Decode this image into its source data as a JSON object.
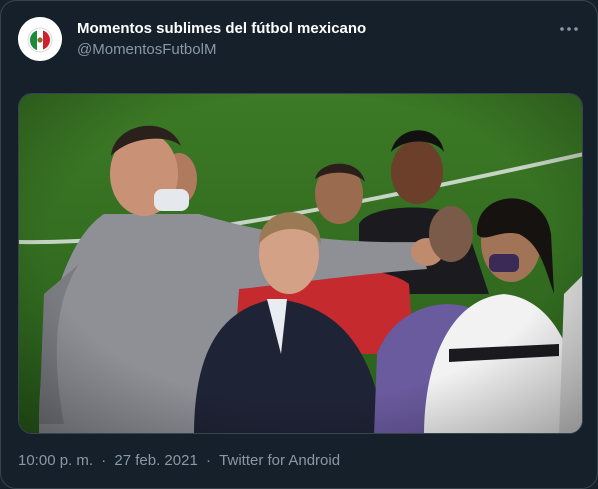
{
  "tweet": {
    "author_name": "Momentos sublimes del fútbol mexicano",
    "author_handle": "@MomentosFutbolM",
    "avatar_icon": "mexico-flag-ball-logo",
    "more_icon": "more-options-icon",
    "media": {
      "type": "video-frame"
    },
    "time": "10:00 p. m.",
    "separator": "·",
    "date": "27 feb. 2021",
    "source": "Twitter for Android"
  },
  "colors": {
    "background": "#15202b",
    "border": "#38444d",
    "text_primary": "#ffffff",
    "text_secondary": "#8899a6",
    "pitch_green": "#2f6b1f"
  }
}
